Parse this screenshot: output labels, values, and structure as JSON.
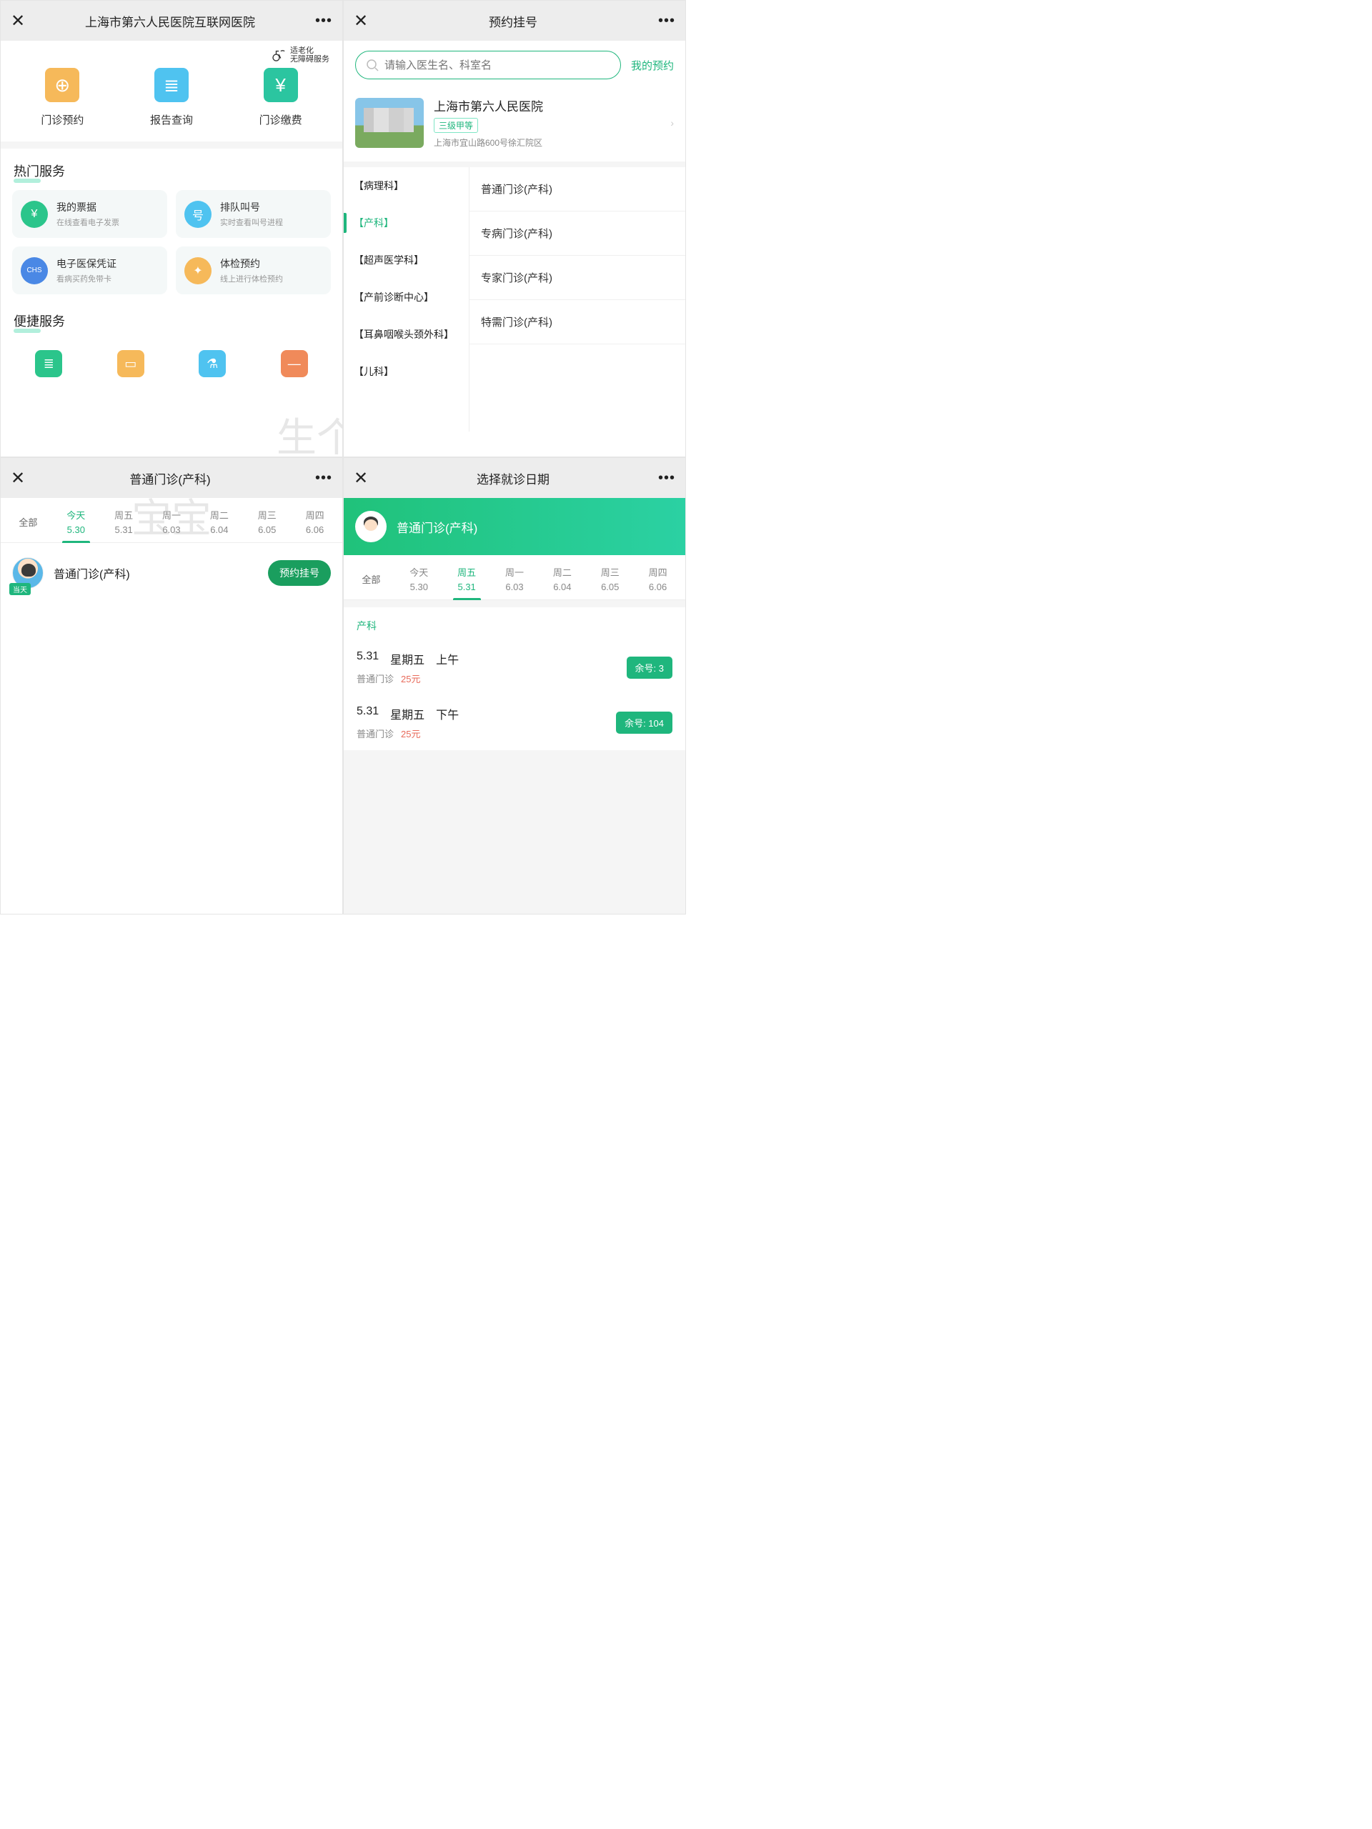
{
  "p1": {
    "title": "上海市第六人民医院互联网医院",
    "accessibility": "适老化\n无障碍服务",
    "quick3": [
      {
        "label": "门诊预约",
        "color": "#f6b95a",
        "glyph": "⊕"
      },
      {
        "label": "报告查询",
        "color": "#4fc3f0",
        "glyph": "≣"
      },
      {
        "label": "门诊缴费",
        "color": "#2bc5a0",
        "glyph": "¥"
      }
    ],
    "hot_title": "热门服务",
    "hot": [
      {
        "t": "我的票据",
        "s": "在线查看电子发票",
        "c": "#2bc58b",
        "g": "¥"
      },
      {
        "t": "排队叫号",
        "s": "实时查看叫号进程",
        "c": "#4fc3f0",
        "g": "号"
      },
      {
        "t": "电子医保凭证",
        "s": "看病买药免带卡",
        "c": "#4a88e5",
        "g": "CHS"
      },
      {
        "t": "体检预约",
        "s": "线上进行体检预约",
        "c": "#f6b95a",
        "g": "✦"
      }
    ],
    "conv_title": "便捷服务",
    "conv": [
      {
        "c": "#2bc58b",
        "g": "≣"
      },
      {
        "c": "#f6b95a",
        "g": "▭"
      },
      {
        "c": "#4fc3f0",
        "g": "⚗"
      },
      {
        "c": "#f08a5a",
        "g": "—"
      }
    ]
  },
  "p2": {
    "title": "预约挂号",
    "search_ph": "请输入医生名、科室名",
    "my": "我的预约",
    "hosp_name": "上海市第六人民医院",
    "hosp_tag": "三级甲等",
    "hosp_addr": "上海市宜山路600号徐汇院区",
    "depts_l": [
      "【病理科】",
      "【产科】",
      "【超声医学科】",
      "【产前诊断中心】",
      "【耳鼻咽喉头颈外科】",
      "【儿科】"
    ],
    "dept_sel": 1,
    "depts_r": [
      "普通门诊(产科)",
      "专病门诊(产科)",
      "专家门诊(产科)",
      "特需门诊(产科)"
    ]
  },
  "p3": {
    "title": "普通门诊(产科)",
    "all": "全部",
    "dates": [
      {
        "w": "今天",
        "d": "5.30",
        "sel": true
      },
      {
        "w": "周五",
        "d": "5.31"
      },
      {
        "w": "周一",
        "d": "6.03"
      },
      {
        "w": "周二",
        "d": "6.04"
      },
      {
        "w": "周三",
        "d": "6.05"
      },
      {
        "w": "周四",
        "d": "6.06"
      }
    ],
    "clinic": "普通门诊(产科)",
    "today_tag": "当天",
    "book": "预约挂号"
  },
  "p4": {
    "title": "选择就诊日期",
    "banner": "普通门诊(产科)",
    "all": "全部",
    "dates": [
      {
        "w": "今天",
        "d": "5.30"
      },
      {
        "w": "周五",
        "d": "5.31",
        "sel": true
      },
      {
        "w": "周一",
        "d": "6.03"
      },
      {
        "w": "周二",
        "d": "6.04"
      },
      {
        "w": "周三",
        "d": "6.05"
      },
      {
        "w": "周四",
        "d": "6.06"
      }
    ],
    "dept_label": "产科",
    "slots": [
      {
        "date": "5.31",
        "dow": "星期五",
        "ampm": "上午",
        "type": "普通门诊",
        "price": "25元",
        "avail": "余号: 3"
      },
      {
        "date": "5.31",
        "dow": "星期五",
        "ampm": "下午",
        "type": "普通门诊",
        "price": "25元",
        "avail": "余号: 104"
      }
    ]
  }
}
